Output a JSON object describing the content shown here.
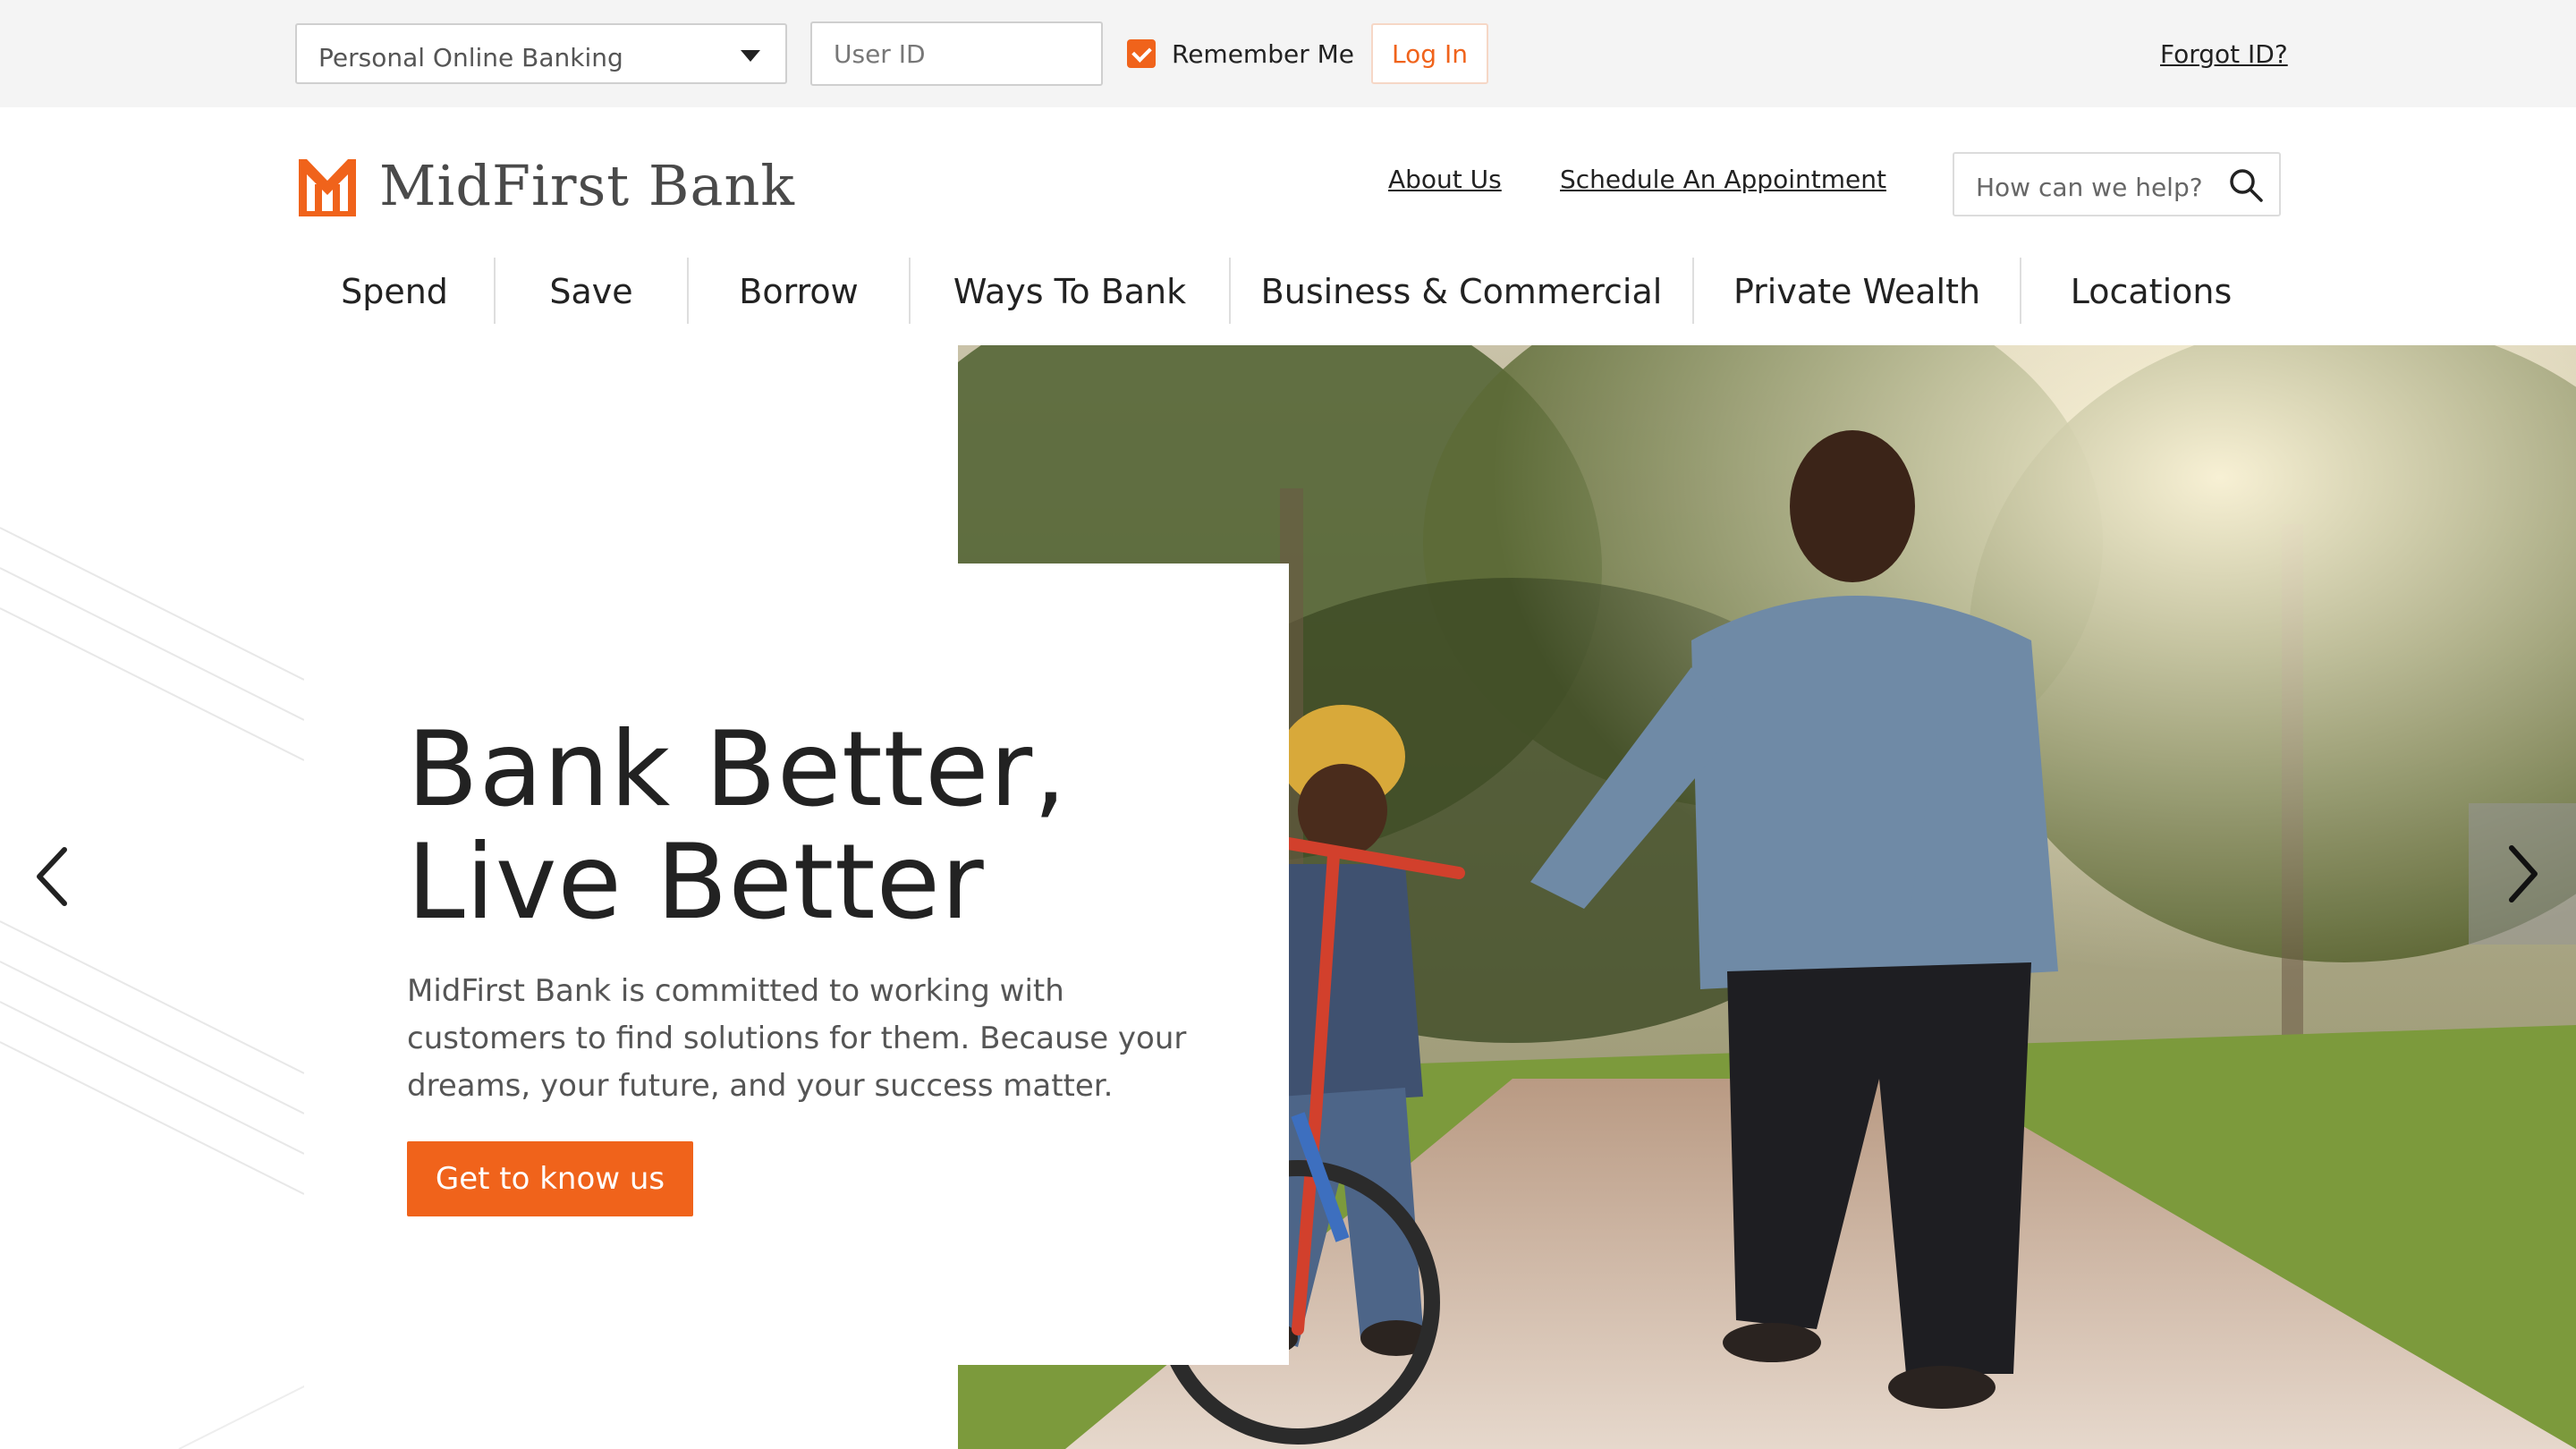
{
  "login_bar": {
    "account_type": "Personal Online Banking",
    "user_id_placeholder": "User ID",
    "remember_label": "Remember Me",
    "remember_checked": true,
    "login_label": "Log In",
    "forgot_label": "Forgot ID?"
  },
  "header": {
    "brand": "MidFirst Bank",
    "utility_links": [
      "About Us",
      "Schedule An Appointment"
    ],
    "search_placeholder": "How can we help?"
  },
  "nav": {
    "items": [
      "Spend",
      "Save",
      "Borrow",
      "Ways To Bank",
      "Business & Commercial",
      "Private Wealth",
      "Locations"
    ]
  },
  "hero": {
    "title_line1": "Bank Better,",
    "title_line2": "Live Better",
    "body": "MidFirst Bank is committed to working with customers to find solutions for them. Because your dreams, your future, and your success matter.",
    "cta_label": "Get to know us"
  },
  "colors": {
    "accent": "#f0631b",
    "topbar_bg": "#f4f4f4",
    "text": "#222222"
  },
  "icons": {
    "account_caret": "chevron-down-icon",
    "search": "search-icon",
    "prev": "chevron-left-icon",
    "next": "chevron-right-icon",
    "logo": "midfirst-logo-icon"
  }
}
